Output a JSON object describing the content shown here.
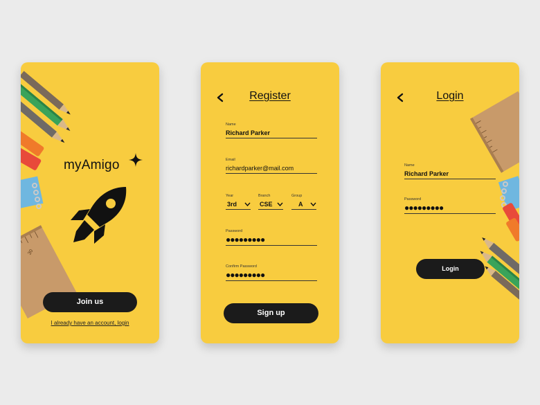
{
  "welcome": {
    "app_name": "myAmigo",
    "join_label": "Join us",
    "login_link": "I already have an account, login",
    "ruler_mark": "30"
  },
  "register": {
    "title": "Register",
    "name": {
      "label": "Name",
      "value": "Richard Parker"
    },
    "email": {
      "label": "Email",
      "value": "richardparker@mail.com"
    },
    "year": {
      "label": "Year",
      "value": "3rd"
    },
    "branch": {
      "label": "Branch",
      "value": "CSE"
    },
    "group": {
      "label": "Group",
      "value": "A"
    },
    "password": {
      "label": "Password",
      "value": "●●●●●●●●●"
    },
    "confirm_password": {
      "label": "Confirm Password",
      "value": "●●●●●●●●●"
    },
    "signup_label": "Sign up"
  },
  "login": {
    "title": "Login",
    "name": {
      "label": "Name",
      "value": "Richard Parker"
    },
    "password": {
      "label": "Password",
      "value": "●●●●●●●●●"
    },
    "login_label": "Login"
  },
  "colors": {
    "background": "#ebebeb",
    "phone_yellow": "#f8cc3f",
    "button_dark": "#1b1b1b"
  },
  "icons": [
    "back-arrow-icon",
    "chevron-down-icon",
    "sparkle-icon",
    "rocket-icon"
  ]
}
